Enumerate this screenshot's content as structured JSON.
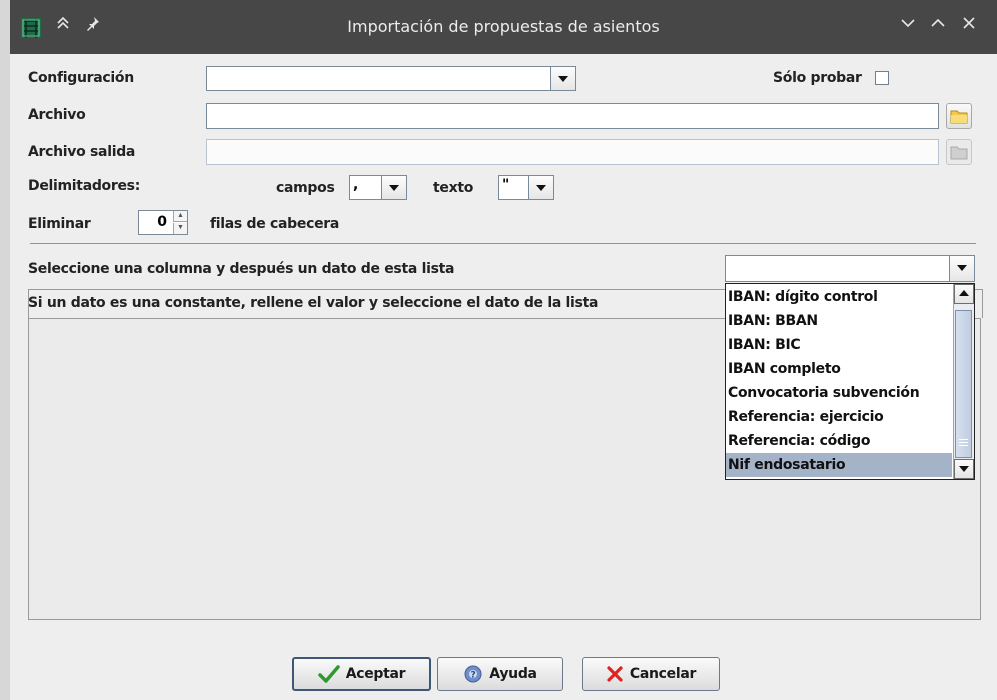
{
  "window": {
    "title": "Importación de propuestas de asientos",
    "icons": {
      "app": "app-grid-icon",
      "shade": "double-chevron-up-icon",
      "pin": "pin-icon",
      "minimize": "chevron-down-icon",
      "maximize": "chevron-up-icon",
      "close": "close-icon"
    },
    "colors": {
      "titlebar": "#474747",
      "accent": "#a5b3c9"
    }
  },
  "form": {
    "configuracion_label": "Configuración",
    "configuracion_value": "",
    "solo_probar_label": "Sólo probar",
    "solo_probar_checked": false,
    "archivo_label": "Archivo",
    "archivo_value": "",
    "archivo_salida_label": "Archivo salida",
    "archivo_salida_value": "",
    "delimitadores_label": "Delimitadores:",
    "campos_label": "campos",
    "campos_value": ",",
    "texto_label": "texto",
    "texto_value": "\"",
    "eliminar_label": "Eliminar",
    "eliminar_value": "0",
    "filas_label": "filas de cabecera"
  },
  "mapping": {
    "instruction1": "Seleccione una columna y después un dato de esta lista",
    "instruction2": "Si un dato es una constante, rellene el valor y seleccione el dato de la lista",
    "combo_value": "",
    "options": [
      "IBAN: dígito control",
      "IBAN: BBAN",
      "IBAN: BIC",
      "IBAN completo",
      "Convocatoria subvención",
      "Referencia: ejercicio",
      "Referencia: código",
      "Nif endosatario"
    ],
    "selected_option": "Nif endosatario"
  },
  "buttons": {
    "aceptar": "Aceptar",
    "ayuda": "Ayuda",
    "cancelar": "Cancelar"
  }
}
